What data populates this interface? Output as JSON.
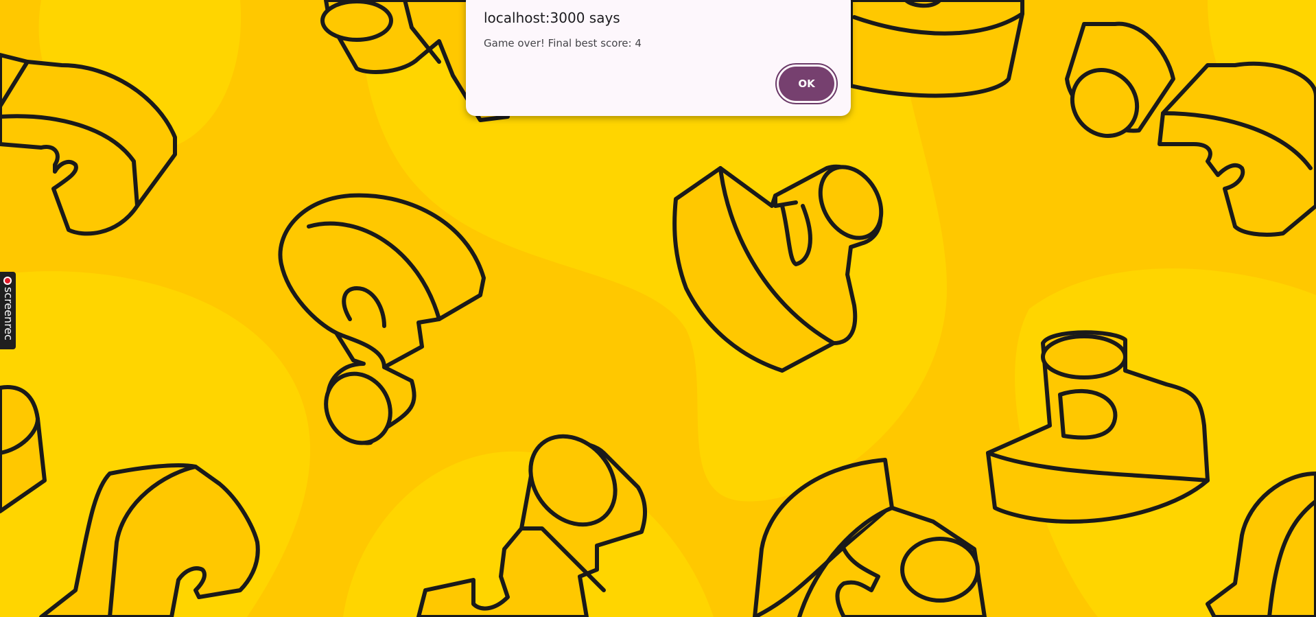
{
  "dialog": {
    "title": "localhost:3000 says",
    "message": "Game over! Final best score: 4",
    "ok_label": "OK"
  },
  "recorder": {
    "label": "screenrec"
  },
  "colors": {
    "background": "#ffc800",
    "background_light": "#ffd500",
    "outline": "#1a1a1a",
    "dialog": "#fdf7fc",
    "button": "#76406f"
  },
  "background_icons": [
    "question-mark-icon"
  ]
}
